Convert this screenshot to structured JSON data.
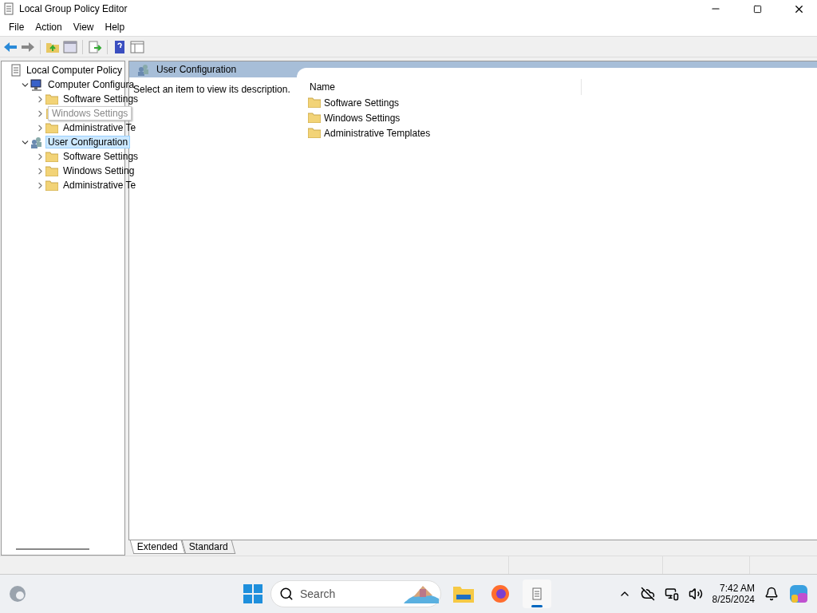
{
  "window": {
    "title": "Local Group Policy Editor"
  },
  "menu": [
    "File",
    "Action",
    "View",
    "Help"
  ],
  "tree": [
    {
      "label": "Local Computer Policy",
      "kind": "root",
      "selected": false,
      "children": [
        {
          "label": "Computer Configura",
          "kind": "computer",
          "expanded": true,
          "selected": false,
          "children": [
            {
              "label": "Software Settings",
              "kind": "folder",
              "expanded": false,
              "selected": false,
              "tooltip": false
            },
            {
              "label": "Windows Settings",
              "kind": "folder",
              "expanded": false,
              "selected": false,
              "tooltip": true
            },
            {
              "label": "Administrative Te",
              "kind": "folder",
              "expanded": false,
              "selected": false,
              "tooltip": false
            }
          ]
        },
        {
          "label": "User Configuration",
          "kind": "user",
          "expanded": true,
          "selected": true,
          "children": [
            {
              "label": "Software Settings",
              "kind": "folder",
              "expanded": false,
              "selected": false,
              "tooltip": false
            },
            {
              "label": "Windows Setting",
              "kind": "folder",
              "expanded": false,
              "selected": false,
              "tooltip": false
            },
            {
              "label": "Administrative Te",
              "kind": "folder",
              "expanded": false,
              "selected": false,
              "tooltip": false
            }
          ]
        }
      ]
    }
  ],
  "detail": {
    "title": "User Configuration",
    "description": "Select an item to view its description.",
    "column": "Name",
    "items": [
      "Software Settings",
      "Windows Settings",
      "Administrative Templates"
    ]
  },
  "view_tabs": [
    {
      "label": "Extended",
      "selected": true
    },
    {
      "label": "Standard",
      "selected": false
    }
  ],
  "taskbar": {
    "search_placeholder": "Search",
    "time": "7:42 AM",
    "date": "8/25/2024"
  }
}
